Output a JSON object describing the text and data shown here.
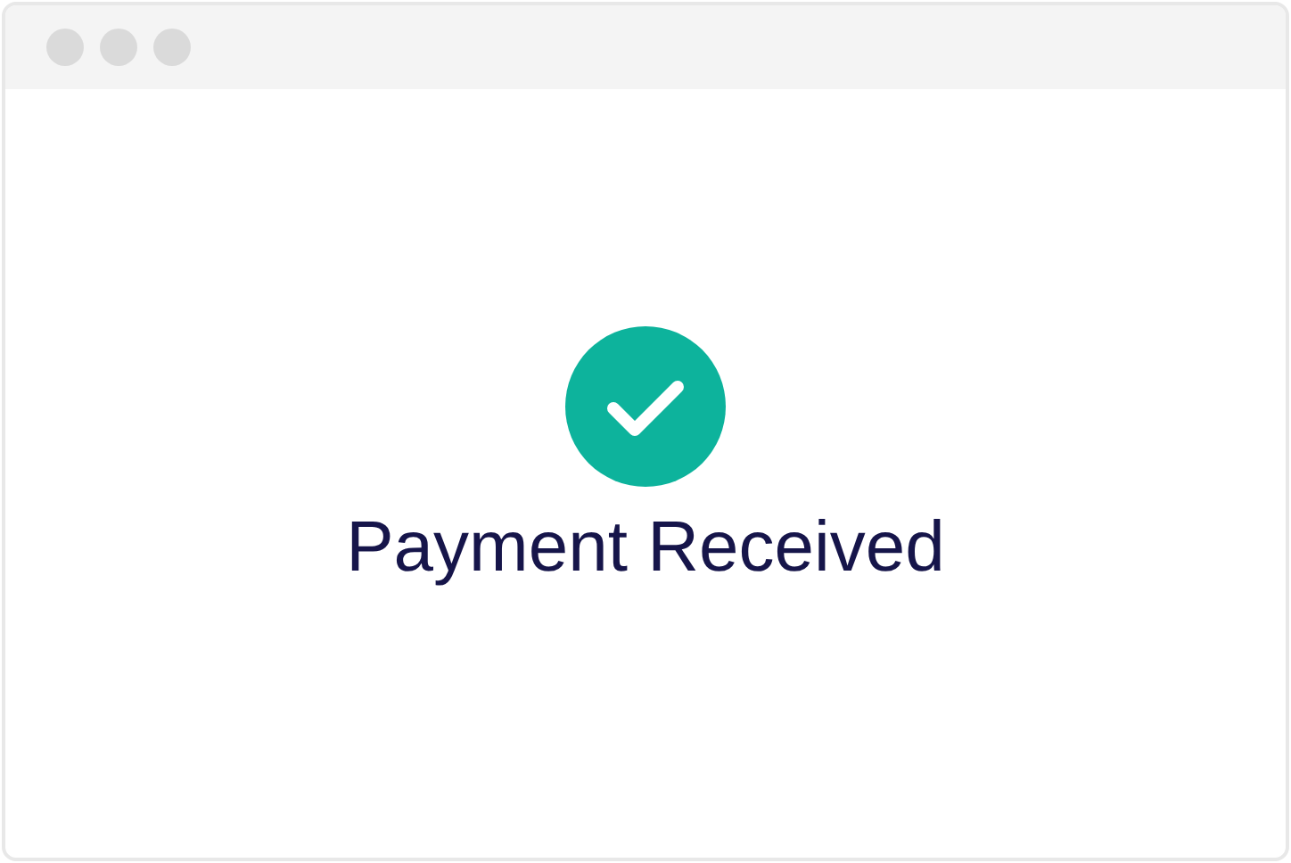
{
  "status": {
    "kind": "success"
  },
  "message": "Payment Received"
}
